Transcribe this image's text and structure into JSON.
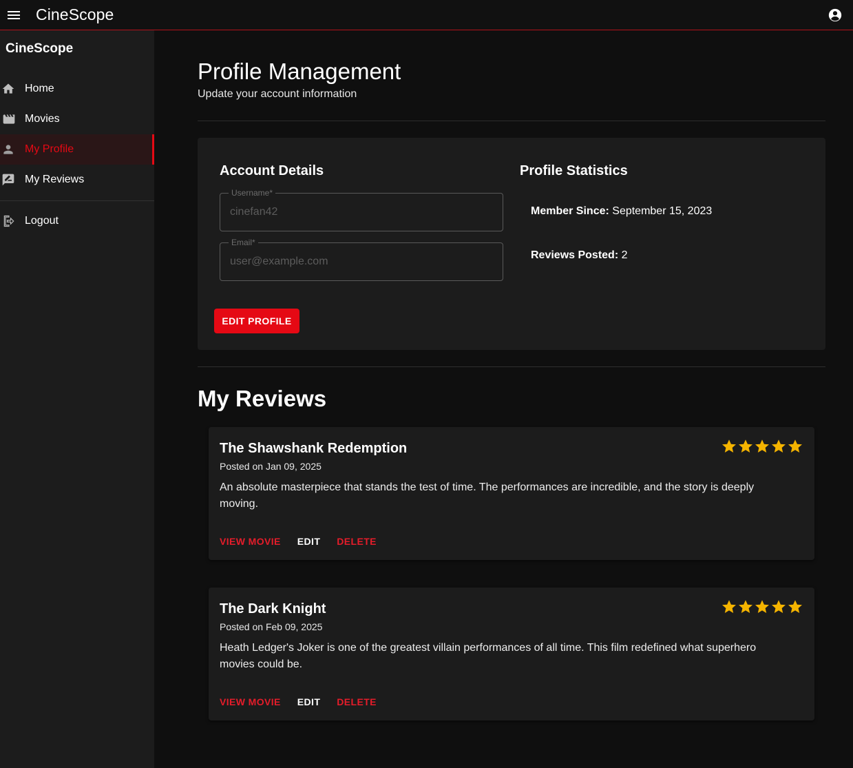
{
  "appbar": {
    "title": "CineScope",
    "menu_icon": "menu-icon",
    "account_icon": "account-circle-icon"
  },
  "sidebar": {
    "brand": "CineScope",
    "items": [
      {
        "label": "Home",
        "icon": "home-icon",
        "active": false
      },
      {
        "label": "Movies",
        "icon": "movie-clapper-icon",
        "active": false
      },
      {
        "label": "My Profile",
        "icon": "person-icon",
        "active": true
      },
      {
        "label": "My Reviews",
        "icon": "rate-review-icon",
        "active": false
      }
    ],
    "logout_label": "Logout"
  },
  "page": {
    "title": "Profile Management",
    "subtitle": "Update your account information"
  },
  "account": {
    "title": "Account Details",
    "username_label": "Username*",
    "username_placeholder": "cinefan42",
    "email_label": "Email*",
    "email_placeholder": "user@example.com",
    "edit_button": "EDIT PROFILE"
  },
  "stats": {
    "title": "Profile Statistics",
    "member_since_label": "Member Since:",
    "member_since_value": "September 15, 2023",
    "reviews_posted_label": "Reviews Posted:",
    "reviews_posted_value": "2"
  },
  "reviews": {
    "title": "My Reviews",
    "items": [
      {
        "movie": "The Shawshank Redemption",
        "date": "Posted on Jan 09, 2025",
        "text": "An absolute masterpiece that stands the test of time. The performances are incredible, and the story is deeply moving.",
        "rating": 5,
        "view_label": "VIEW MOVIE",
        "edit_label": "EDIT",
        "delete_label": "DELETE"
      },
      {
        "movie": "The Dark Knight",
        "date": "Posted on Feb 09, 2025",
        "text": "Heath Ledger's Joker is one of the greatest villain performances of all time. This film redefined what superhero movies could be.",
        "rating": 5,
        "view_label": "VIEW MOVIE",
        "edit_label": "EDIT",
        "delete_label": "DELETE"
      }
    ]
  },
  "colors": {
    "accent": "#e50914",
    "star": "#f5b400",
    "background": "#0f0f0f",
    "surface": "#1c1c1c"
  }
}
